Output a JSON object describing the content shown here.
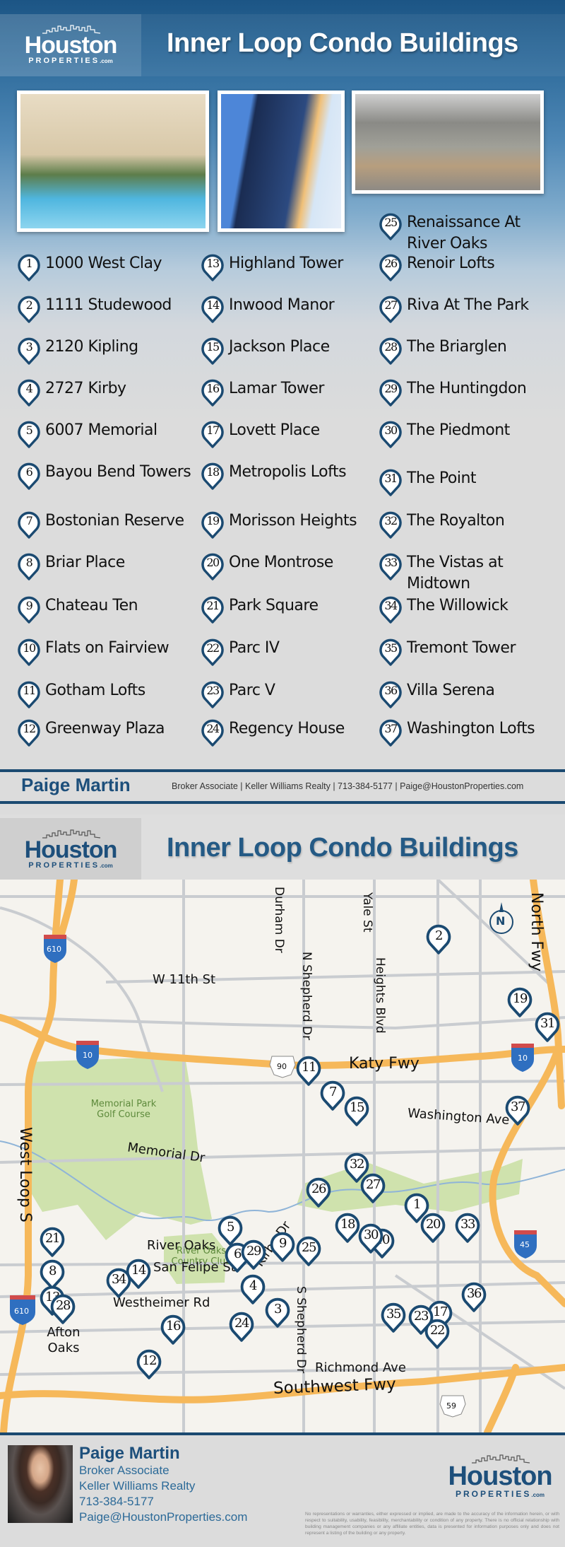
{
  "brand": {
    "logo_word": "Houston",
    "logo_sub": "PROPERTIES",
    "logo_tld": ".com",
    "navy": "#1b4a71",
    "pin_color": "#1b4a71"
  },
  "header": {
    "title": "Inner Loop Condo Buildings"
  },
  "photos": [
    {
      "name": "pool-tower-photo"
    },
    {
      "name": "glass-tower-photo"
    },
    {
      "name": "midrise-entrance-photo"
    }
  ],
  "buildings": [
    {
      "num": "1",
      "name": "1000 West Clay"
    },
    {
      "num": "2",
      "name": "1111 Studewood"
    },
    {
      "num": "3",
      "name": "2120 Kipling"
    },
    {
      "num": "4",
      "name": "2727 Kirby"
    },
    {
      "num": "5",
      "name": "6007 Memorial"
    },
    {
      "num": "6",
      "name": "Bayou Bend Towers"
    },
    {
      "num": "7",
      "name": "Bostonian Reserve"
    },
    {
      "num": "8",
      "name": "Briar Place"
    },
    {
      "num": "9",
      "name": "Chateau Ten"
    },
    {
      "num": "10",
      "name": "Flats on Fairview"
    },
    {
      "num": "11",
      "name": "Gotham Lofts"
    },
    {
      "num": "12",
      "name": "Greenway Plaza"
    },
    {
      "num": "13",
      "name": "Highland Tower"
    },
    {
      "num": "14",
      "name": "Inwood Manor"
    },
    {
      "num": "15",
      "name": "Jackson Place"
    },
    {
      "num": "16",
      "name": "Lamar Tower"
    },
    {
      "num": "17",
      "name": "Lovett Place"
    },
    {
      "num": "18",
      "name": "Metropolis Lofts"
    },
    {
      "num": "19",
      "name": "Morisson Heights"
    },
    {
      "num": "20",
      "name": "One Montrose"
    },
    {
      "num": "21",
      "name": "Park Square"
    },
    {
      "num": "22",
      "name": "Parc IV"
    },
    {
      "num": "23",
      "name": "Parc V"
    },
    {
      "num": "24",
      "name": "Regency House"
    },
    {
      "num": "25",
      "name": "Renaissance At River Oaks"
    },
    {
      "num": "26",
      "name": "Renoir Lofts"
    },
    {
      "num": "27",
      "name": "Riva At The Park"
    },
    {
      "num": "28",
      "name": "The Briarglen"
    },
    {
      "num": "29",
      "name": "The Huntingdon"
    },
    {
      "num": "30",
      "name": "The Piedmont"
    },
    {
      "num": "31",
      "name": "The Point"
    },
    {
      "num": "32",
      "name": "The Royalton"
    },
    {
      "num": "33",
      "name": "The Vistas at Midtown"
    },
    {
      "num": "34",
      "name": "The Willowick"
    },
    {
      "num": "35",
      "name": "Tremont Tower"
    },
    {
      "num": "36",
      "name": "Villa Serena"
    },
    {
      "num": "37",
      "name": "Washington Lofts"
    }
  ],
  "agent_strip": {
    "name": "Paige Martin",
    "info": "Broker Associate | Keller Williams Realty | 713-384-5177 | Paige@HoustonProperties.com"
  },
  "map": {
    "compass": "N",
    "shields": {
      "i610": "610",
      "i10": "10",
      "i45": "45",
      "us90": "90",
      "us59": "59"
    },
    "labels": {
      "w11th": "W 11th St",
      "durham": "Durham Dr",
      "yale": "Yale St",
      "nshepherd": "N Shepherd Dr",
      "heights": "Heights Blvd",
      "northfwy": "North Fwy",
      "katyfwy": "Katy Fwy",
      "washington": "Washington Ave",
      "memorialpark": "Memorial Park Golf Course",
      "memorialdr": "Memorial Dr",
      "westloop": "West Loop S",
      "riveroakscc": "River Oaks Country Club",
      "kirby": "Kirby Dr",
      "riveroaks": "River Oaks",
      "sanfelipe": "San Felipe St",
      "westheimer": "Westheimer Rd",
      "sshepherd": "S Shepherd Dr",
      "afton": "Afton Oaks",
      "richmond": "Richmond Ave",
      "southwest": "Southwest Fwy"
    }
  },
  "footer": {
    "name": "Paige Martin",
    "title": "Broker Associate",
    "company": "Keller Williams Realty",
    "phone": "713-384-5177",
    "email": "Paige@HoustonProperties.com",
    "disclaimer": "No representations or warranties, either expressed or implied, are made to the accuracy of the information herein, or with respect to suitability, usability, feasibility, merchantability or condition of any property. There is no official relationship with building management companies or any affiliate entities, data is presented for information purposes only and does not represent a listing of the building or any property."
  }
}
